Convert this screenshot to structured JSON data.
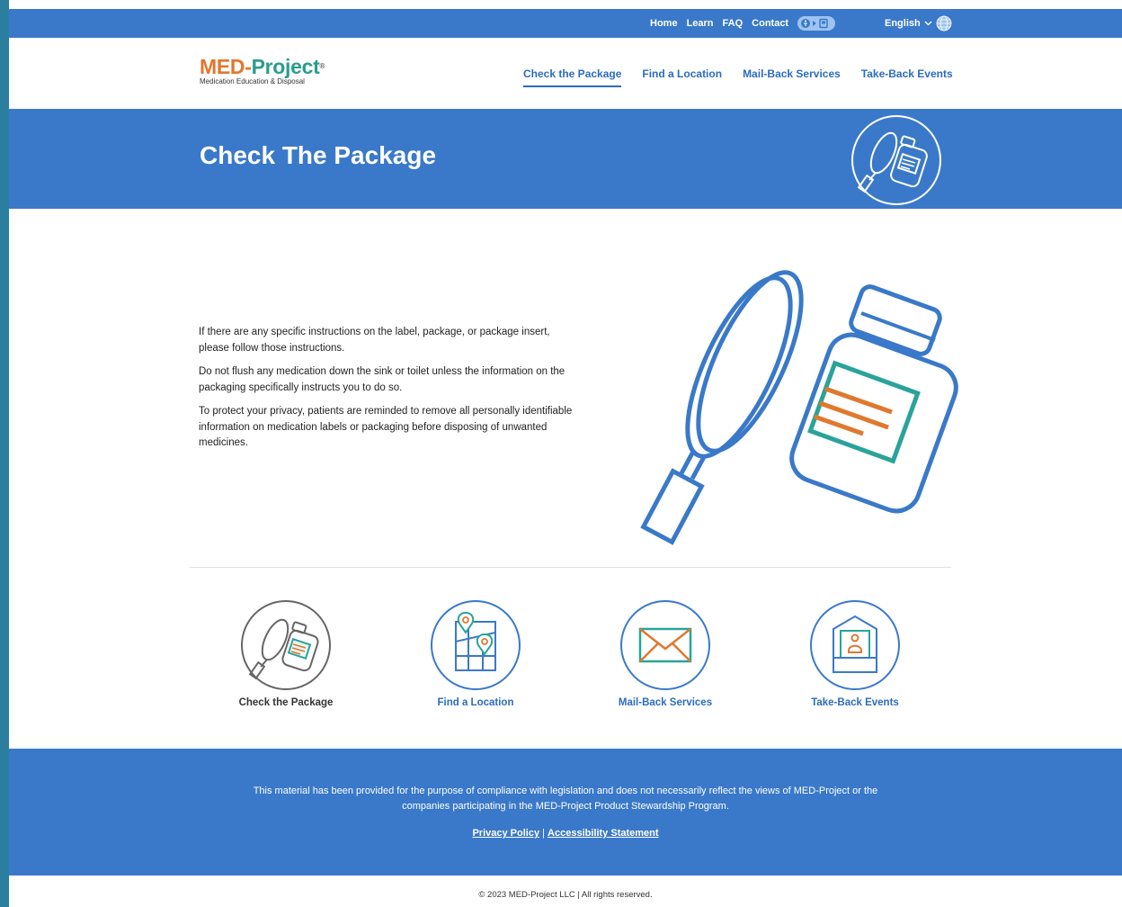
{
  "utility_nav": {
    "home": "Home",
    "learn": "Learn",
    "faq": "FAQ",
    "contact": "Contact",
    "language": "English"
  },
  "logo": {
    "name_part1": "MED-",
    "name_part2": "Project",
    "trademark": "®",
    "tagline": "Medication Education & Disposal"
  },
  "main_nav": {
    "items": [
      {
        "label": "Check the Package",
        "active": true
      },
      {
        "label": "Find a Location",
        "active": false
      },
      {
        "label": "Mail-Back Services",
        "active": false
      },
      {
        "label": "Take-Back Events",
        "active": false
      }
    ]
  },
  "hero": {
    "title": "Check The Package"
  },
  "content": {
    "paragraphs": [
      "If there are any specific instructions on the label, package, or package insert, please follow those instructions.",
      "Do not flush any medication down the sink or toilet unless the information on the packaging specifically instructs you to do so.",
      "To protect your privacy, patients are reminded to remove all personally identifiable information on medication labels or packaging before disposing of unwanted medicines."
    ]
  },
  "cards": [
    {
      "label": "Check the Package",
      "icon": "magnifier-bottle-icon"
    },
    {
      "label": "Find a Location",
      "icon": "map-pin-icon"
    },
    {
      "label": "Mail-Back Services",
      "icon": "envelope-icon"
    },
    {
      "label": "Take-Back Events",
      "icon": "booth-icon"
    }
  ],
  "footer": {
    "line1": "This material has been provided for the purpose of compliance with legislation and does not necessarily reflect the views of MED-Project or the",
    "line2": "companies participating in the MED-Project Product Stewardship Program.",
    "privacy": "Privacy Policy",
    "separator": "|",
    "accessibility": "Accessibility Statement"
  },
  "copyright": "© 2023 MED-Project LLC | All rights reserved.",
  "colors": {
    "brand_blue": "#3a79c9",
    "link_blue": "#2b6cbf",
    "orange": "#e0782e",
    "teal": "#2a9c8f"
  }
}
